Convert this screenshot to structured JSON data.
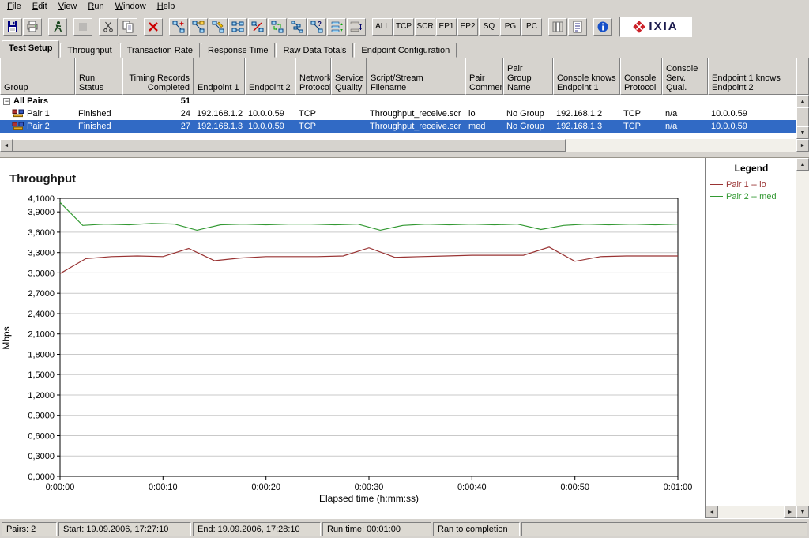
{
  "colors": {
    "chrome": "#d6d3ce",
    "selection": "#316ac5",
    "grid_line": "#c9c9c9",
    "pair1_line": "#993333",
    "pair2_line": "#339933",
    "logo_red": "#cc2229"
  },
  "menu_bar": {
    "items": [
      "File",
      "Edit",
      "View",
      "Run",
      "Window",
      "Help"
    ]
  },
  "toolbar": {
    "items": [
      {
        "type": "icon",
        "name": "save-icon"
      },
      {
        "type": "icon",
        "name": "print-icon"
      },
      {
        "type": "sep"
      },
      {
        "type": "icon",
        "name": "run-test-icon"
      },
      {
        "type": "sep"
      },
      {
        "type": "icon",
        "name": "stop-run-icon",
        "disabled": true
      },
      {
        "type": "sep"
      },
      {
        "type": "icon",
        "name": "cut-icon"
      },
      {
        "type": "icon",
        "name": "copy-icon"
      },
      {
        "type": "sep"
      },
      {
        "type": "icon",
        "name": "delete-icon"
      },
      {
        "type": "sep"
      },
      {
        "type": "icon",
        "name": "add-pair-icon"
      },
      {
        "type": "icon",
        "name": "add-multicast-group-icon"
      },
      {
        "type": "icon",
        "name": "edit-pair-icon"
      },
      {
        "type": "icon",
        "name": "connect-pairs-icon"
      },
      {
        "type": "icon",
        "name": "disconnect-pairs-icon"
      },
      {
        "type": "icon",
        "name": "swap-endpoints-icon"
      },
      {
        "type": "icon",
        "name": "replicate-pair-icon"
      },
      {
        "type": "icon",
        "name": "pair-attributes-icon"
      },
      {
        "type": "icon",
        "name": "reorder-pairs-icon"
      },
      {
        "type": "icon",
        "name": "swap-pair-rows-icon"
      },
      {
        "type": "sep"
      },
      {
        "type": "text",
        "label": "ALL"
      },
      {
        "type": "text",
        "label": "TCP"
      },
      {
        "type": "text",
        "label": "SCR"
      },
      {
        "type": "text",
        "label": "EP1"
      },
      {
        "type": "text",
        "label": "EP2"
      },
      {
        "type": "text",
        "label": "SQ"
      },
      {
        "type": "text",
        "label": "PG"
      },
      {
        "type": "text",
        "label": "PC"
      },
      {
        "type": "sep"
      },
      {
        "type": "icon",
        "name": "column-chooser-icon"
      },
      {
        "type": "icon",
        "name": "report-icon"
      },
      {
        "type": "sep"
      },
      {
        "type": "icon",
        "name": "about-info-icon"
      },
      {
        "type": "logo",
        "label": "IXIA"
      }
    ]
  },
  "tabs": {
    "active": "Test Setup",
    "items": [
      "Test Setup",
      "Throughput",
      "Transaction Rate",
      "Response Time",
      "Raw Data Totals",
      "Endpoint Configuration"
    ]
  },
  "pairs_table": {
    "columns": [
      {
        "key": "group",
        "label": "Group",
        "width": 95
      },
      {
        "key": "run_status",
        "label": "Run Status",
        "width": 60
      },
      {
        "key": "timing_records",
        "label": "Timing Records\nCompleted",
        "width": 90,
        "align": "right"
      },
      {
        "key": "endpoint1",
        "label": "Endpoint 1",
        "width": 65
      },
      {
        "key": "endpoint2",
        "label": "Endpoint 2",
        "width": 64
      },
      {
        "key": "network_protocol",
        "label": "Network\nProtocol",
        "width": 45
      },
      {
        "key": "service_quality",
        "label": "Service\nQuality",
        "width": 45
      },
      {
        "key": "script",
        "label": "Script/Stream\nFilename",
        "width": 125
      },
      {
        "key": "pair_comment",
        "label": "Pair\nComment",
        "width": 48
      },
      {
        "key": "pair_group",
        "label": "Pair Group\nName",
        "width": 63
      },
      {
        "key": "console_knows_ep1",
        "label": "Console knows\nEndpoint 1",
        "width": 85
      },
      {
        "key": "console_protocol",
        "label": "Console\nProtocol",
        "width": 53
      },
      {
        "key": "console_sq",
        "label": "Console\nServ. Qual.",
        "width": 58
      },
      {
        "key": "ep1_knows_ep2",
        "label": "Endpoint 1 knows\nEndpoint 2",
        "width": 112
      }
    ],
    "rows": [
      {
        "type": "summary",
        "group": "All Pairs",
        "timing_records": "51",
        "selected": false
      },
      {
        "type": "pair",
        "group": "Pair 1",
        "run_status": "Finished",
        "timing_records": "24",
        "endpoint1": "192.168.1.2",
        "endpoint2": "10.0.0.59",
        "network_protocol": "TCP",
        "service_quality": "",
        "script": "Throughput_receive.scr",
        "pair_comment": "lo",
        "pair_group": "No Group",
        "console_knows_ep1": "192.168.1.2",
        "console_protocol": "TCP",
        "console_sq": "n/a",
        "ep1_knows_ep2": "10.0.0.59",
        "selected": false
      },
      {
        "type": "pair",
        "group": "Pair 2",
        "run_status": "Finished",
        "timing_records": "27",
        "endpoint1": "192.168.1.3",
        "endpoint2": "10.0.0.59",
        "network_protocol": "TCP",
        "service_quality": "",
        "script": "Throughput_receive.scr",
        "pair_comment": "med",
        "pair_group": "No Group",
        "console_knows_ep1": "192.168.1.3",
        "console_protocol": "TCP",
        "console_sq": "n/a",
        "ep1_knows_ep2": "10.0.0.59",
        "selected": true
      }
    ]
  },
  "chart_data": {
    "type": "line",
    "title": "Throughput",
    "xlabel": "Elapsed time (h:mm:ss)",
    "ylabel": "Mbps",
    "ylim": [
      0,
      4.1
    ],
    "grid": "horizontal",
    "legend_position": "right",
    "y_ticks": [
      {
        "value": 4.1,
        "label": "4,1000"
      },
      {
        "value": 3.9,
        "label": "3,9000"
      },
      {
        "value": 3.6,
        "label": "3,6000"
      },
      {
        "value": 3.3,
        "label": "3,3000"
      },
      {
        "value": 3.0,
        "label": "3,0000"
      },
      {
        "value": 2.7,
        "label": "2,7000"
      },
      {
        "value": 2.4,
        "label": "2,4000"
      },
      {
        "value": 2.1,
        "label": "2,1000"
      },
      {
        "value": 1.8,
        "label": "1,8000"
      },
      {
        "value": 1.5,
        "label": "1,5000"
      },
      {
        "value": 1.2,
        "label": "1,2000"
      },
      {
        "value": 0.9,
        "label": "0,9000"
      },
      {
        "value": 0.6,
        "label": "0,6000"
      },
      {
        "value": 0.3,
        "label": "0,3000"
      },
      {
        "value": 0.0,
        "label": "0,0000"
      }
    ],
    "x_ticks": [
      {
        "value": 0,
        "label": "0:00:00"
      },
      {
        "value": 10,
        "label": "0:00:10"
      },
      {
        "value": 20,
        "label": "0:00:20"
      },
      {
        "value": 30,
        "label": "0:00:30"
      },
      {
        "value": 40,
        "label": "0:00:40"
      },
      {
        "value": 50,
        "label": "0:00:50"
      },
      {
        "value": 60,
        "label": "0:01:00"
      }
    ],
    "series": [
      {
        "name": "Pair 1 -- lo",
        "color": "#993333",
        "x": [
          0,
          2.5,
          5,
          7.5,
          10,
          12.5,
          15,
          17.5,
          20,
          22.5,
          25,
          27.5,
          30,
          32.5,
          35,
          37.5,
          40,
          42.5,
          45,
          47.5,
          50,
          52.5,
          55,
          57.5,
          60
        ],
        "y": [
          2.99,
          3.21,
          3.24,
          3.25,
          3.24,
          3.36,
          3.18,
          3.22,
          3.24,
          3.24,
          3.24,
          3.25,
          3.37,
          3.23,
          3.24,
          3.25,
          3.26,
          3.26,
          3.26,
          3.38,
          3.17,
          3.24,
          3.25,
          3.25,
          3.25
        ]
      },
      {
        "name": "Pair 2 -- med",
        "color": "#339933",
        "x": [
          0,
          2.2,
          4.4,
          6.7,
          8.9,
          11.1,
          13.3,
          15.6,
          17.8,
          20,
          22.2,
          24.4,
          26.7,
          28.9,
          31.1,
          33.3,
          35.6,
          37.8,
          40,
          42.2,
          44.4,
          46.7,
          48.9,
          51.1,
          53.3,
          55.6,
          57.8,
          60
        ],
        "y": [
          4.04,
          3.7,
          3.72,
          3.71,
          3.73,
          3.72,
          3.63,
          3.71,
          3.72,
          3.71,
          3.72,
          3.72,
          3.71,
          3.72,
          3.63,
          3.7,
          3.72,
          3.71,
          3.72,
          3.71,
          3.72,
          3.64,
          3.7,
          3.72,
          3.71,
          3.72,
          3.71,
          3.72
        ]
      }
    ]
  },
  "legend": {
    "title": "Legend",
    "items": [
      {
        "label": "Pair 1 -- lo",
        "color": "#993333"
      },
      {
        "label": "Pair 2 -- med",
        "color": "#339933"
      }
    ]
  },
  "status_bar": {
    "panels": [
      {
        "name": "pairs-count",
        "text": "Pairs: 2",
        "width": 70
      },
      {
        "name": "start-time",
        "text": "Start: 19.09.2006, 17:27:10",
        "width": 168
      },
      {
        "name": "end-time",
        "text": "End: 19.09.2006, 17:28:10",
        "width": 162
      },
      {
        "name": "run-time",
        "text": "Run time: 00:01:00",
        "width": 138
      },
      {
        "name": "run-result",
        "text": "Ran to completion",
        "width": 110
      }
    ]
  }
}
